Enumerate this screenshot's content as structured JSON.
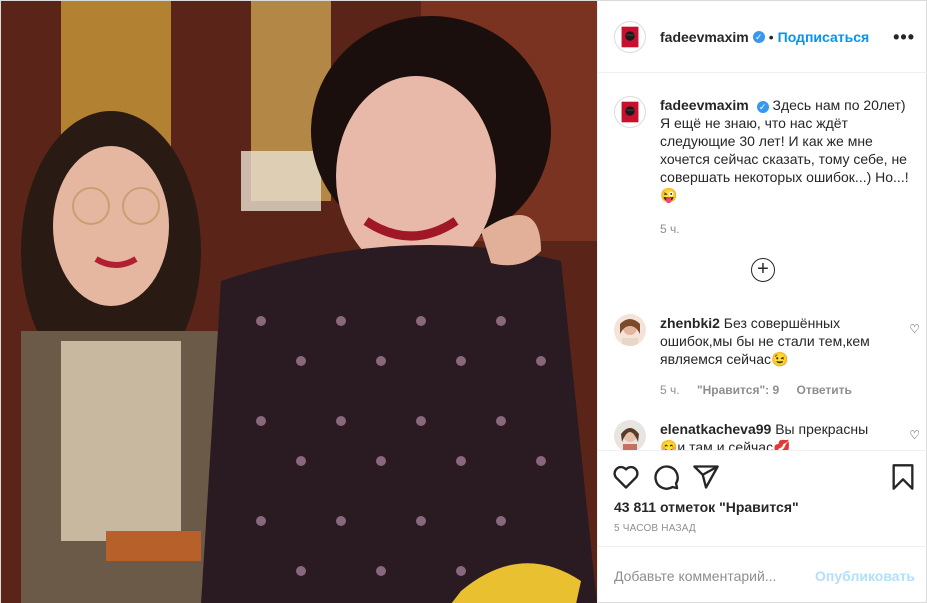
{
  "post": {
    "photo_alt": "",
    "author": {
      "username": "fadeevmaxim",
      "follow_label": "Подписаться",
      "separator": "•",
      "more_label": "•••"
    },
    "caption": {
      "username": "fadeevmaxim",
      "text": "Здесь нам по 20лет) Я ещё не знаю, что нас ждёт следующие 30 лет! И как же мне хочется сейчас сказать, тому себе, не совершать некоторых ошибок...) Но...!😜",
      "time": "5 ч."
    },
    "load_more_label": "+",
    "comments": [
      {
        "username": "zhenbki2",
        "text": "Без совершённых ошибок,мы бы не стали тем,кем являемся сейчас😉",
        "time": "5 ч.",
        "likes": "\"Нравится\": 9",
        "reply": "Ответить"
      },
      {
        "username": "elenatkacheva99",
        "text": "Вы прекрасны 😊и там и сейчас💋",
        "time": "",
        "likes": "",
        "reply": ""
      }
    ],
    "likes_text": "43 811 отметок \"Нравится\"",
    "posted_text": "5 ЧАСОВ НАЗАД",
    "comment_placeholder": "Добавьте комментарий...",
    "publish_label": "Опубликовать"
  },
  "colors": {
    "accent": "#0095f6",
    "publish_disabled": "#b2dffc",
    "verified": "#3897f0"
  }
}
